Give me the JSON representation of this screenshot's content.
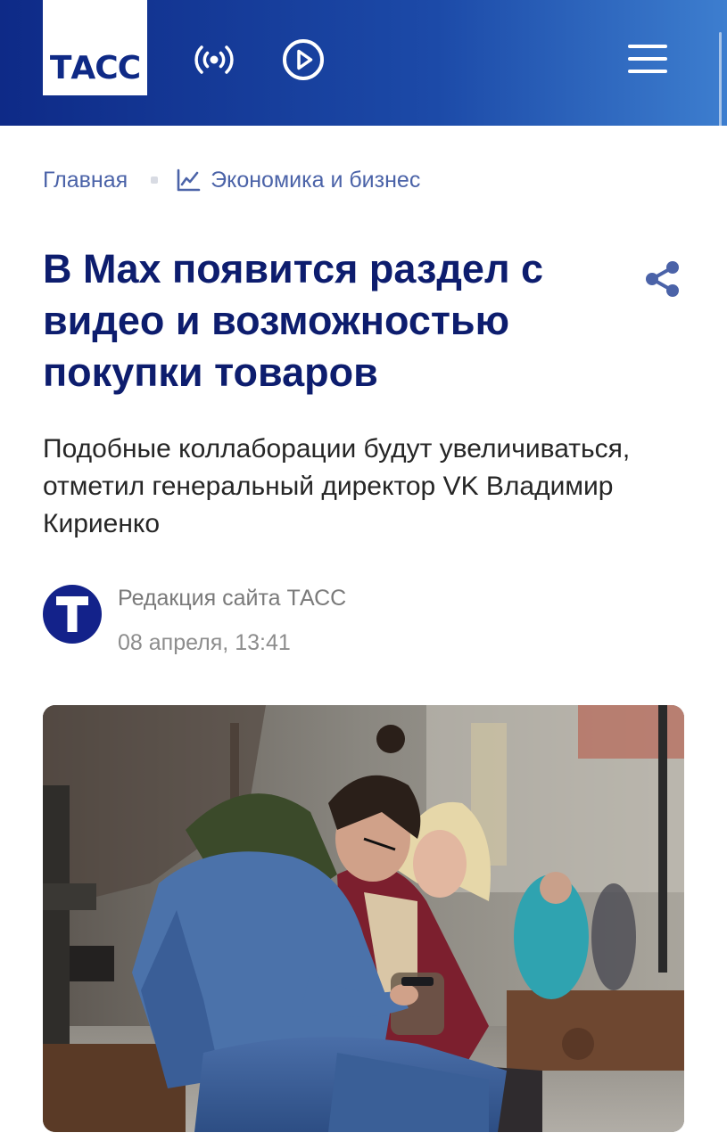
{
  "header": {
    "logo_text": "ТАСС",
    "icons": [
      "radio-broadcast-icon",
      "play-icon",
      "menu-icon"
    ]
  },
  "breadcrumb": {
    "home_label": "Главная",
    "section_label": "Экономика и бизнес",
    "section_icon": "chart-line-icon"
  },
  "article": {
    "title": "В Max появится раздел с видео и возможностью покупки товаров",
    "lead": "Подобные коллаборации будут увеличиваться, отметил генеральный директор VK Владимир Кириенко",
    "author": "Редакция сайта ТАСС",
    "author_avatar_letter": "Т",
    "date": "08 апреля, 13:41"
  },
  "colors": {
    "brand_navy": "#0d1d6e",
    "header_gradient_start": "#0e2a87",
    "header_gradient_end": "#3d7ecf",
    "link_blue": "#4b63a8"
  }
}
